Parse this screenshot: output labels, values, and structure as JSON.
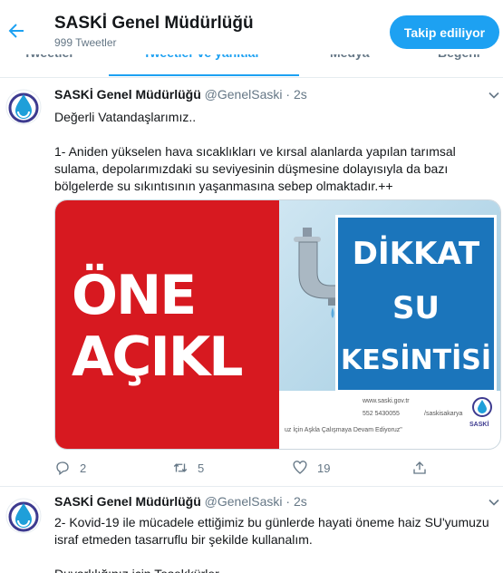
{
  "header": {
    "title": "SASKİ Genel Müdürlüğü",
    "tweet_count": "999 Tweetler",
    "follow_label": "Takip ediliyor"
  },
  "tabs": [
    {
      "label": "Tweetler",
      "active": false
    },
    {
      "label": "Tweetler ve yanıtlar",
      "active": true
    },
    {
      "label": "Medya",
      "active": false
    },
    {
      "label": "Beğeni",
      "active": false
    }
  ],
  "tweets": [
    {
      "name": "SASKİ Genel Müdürlüğü",
      "handle": "@GenelSaski",
      "dot": "·",
      "time": "2s",
      "text": "Değerli Vatandaşlarımız..\n\n1- Aniden yükselen hava sıcaklıkları ve kırsal alanlarda yapılan tarımsal sulama, depolarımızdaki su seviyesinin düşmesine dolayısıyla da bazı bölgelerde su sıkıntısının yaşanmasına sebep olmaktadır.++",
      "media": {
        "left_line1": "ÖNE",
        "left_line2": "AÇIKL",
        "right_line1": "DİKKAT",
        "right_line2": "SU",
        "right_line3": "KESİNTİSİ",
        "strip_web": "www.saski.gov.tr",
        "strip_phone": "552 5430055",
        "strip_slogan": "uz İçin Aşkla Çalışmaya Devam Ediyoruz\"",
        "strip_brand": "SASKİ",
        "strip_handle": "/saskisakarya"
      },
      "replies": "2",
      "retweets": "5",
      "likes": "19"
    },
    {
      "name": "SASKİ Genel Müdürlüğü",
      "handle": "@GenelSaski",
      "dot": "·",
      "time": "2s",
      "text": "2- Kovid-19 ile mücadele ettiğimiz bu günlerde hayati öneme haiz SU'yumuzu israf etmeden tasarruflu bir şekilde kullanalım.\n\nDuyarlılığınız için Teşekkürler."
    }
  ],
  "colors": {
    "accent": "#1da1f2",
    "red_banner": "#d71920",
    "sign_blue": "#1b75bb"
  }
}
